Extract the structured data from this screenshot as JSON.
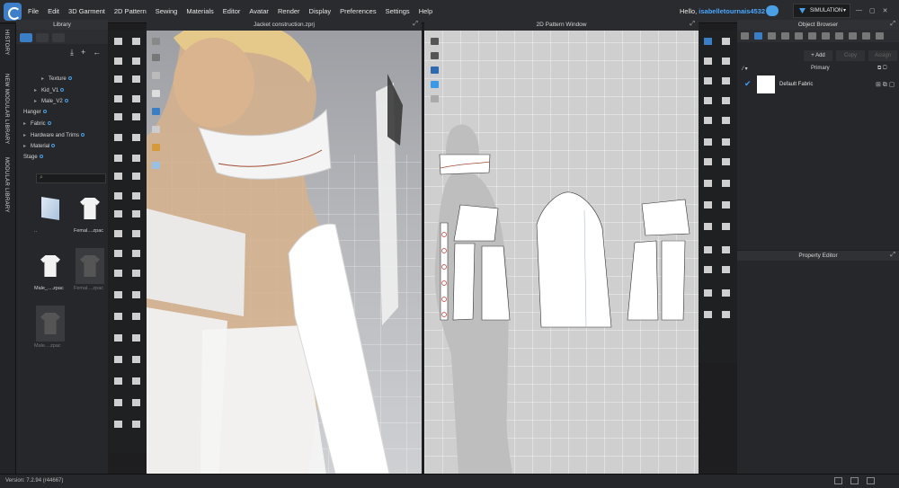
{
  "menu": {
    "items": [
      "File",
      "Edit",
      "3D Garment",
      "2D Pattern",
      "Sewing",
      "Materials",
      "Editor",
      "Avatar",
      "Render",
      "Display",
      "Preferences",
      "Settings",
      "Help"
    ],
    "hello": "Hello,",
    "username": "isabelletournais4532",
    "mode": "SIMULATION"
  },
  "side_tabs": [
    "HISTORY",
    "NEW MODULAR LIBRARY",
    "MODULAR LIBRARY"
  ],
  "library": {
    "title": "Library",
    "tree": [
      {
        "label": "Texture",
        "indent": 2,
        "expanded": false
      },
      {
        "label": "Kid_V1",
        "indent": 2,
        "expanded": false
      },
      {
        "label": "Male_V2",
        "indent": 2,
        "expanded": false
      },
      {
        "label": "Hanger",
        "indent": 1,
        "expanded": false
      },
      {
        "label": "Fabric",
        "indent": 0,
        "expanded": false
      },
      {
        "label": "Hardware and Trims",
        "indent": 0,
        "expanded": false
      },
      {
        "label": "Material",
        "indent": 0,
        "expanded": false
      },
      {
        "label": "Stage",
        "indent": 1,
        "expanded": false
      }
    ],
    "thumbnails": [
      {
        "caption": "..",
        "kind": "folder",
        "dim": false
      },
      {
        "caption": "Femal....zpac",
        "kind": "white-tee",
        "dim": false
      },
      {
        "caption": "Male_....zpac",
        "kind": "white-tee",
        "dim": false
      },
      {
        "caption": "Femal....zpac",
        "kind": "dark-tee",
        "dim": true
      },
      {
        "caption": "Male....zpac",
        "kind": "dark-tee",
        "dim": true
      }
    ]
  },
  "window3d": {
    "title": "Jacket construction.zprj"
  },
  "window2d": {
    "title": "2D Pattern Window"
  },
  "object_browser": {
    "title": "Object Browser",
    "buttons": [
      "+ Add",
      "Copy",
      "Assign"
    ],
    "group": "Primary",
    "fabric": "Default Fabric"
  },
  "property_editor": {
    "title": "Property Editor"
  },
  "status": {
    "version": "Version: 7.2.94 (r44667)"
  },
  "colors": {
    "accent": "#3a7ec6",
    "username": "#49a7ff"
  }
}
